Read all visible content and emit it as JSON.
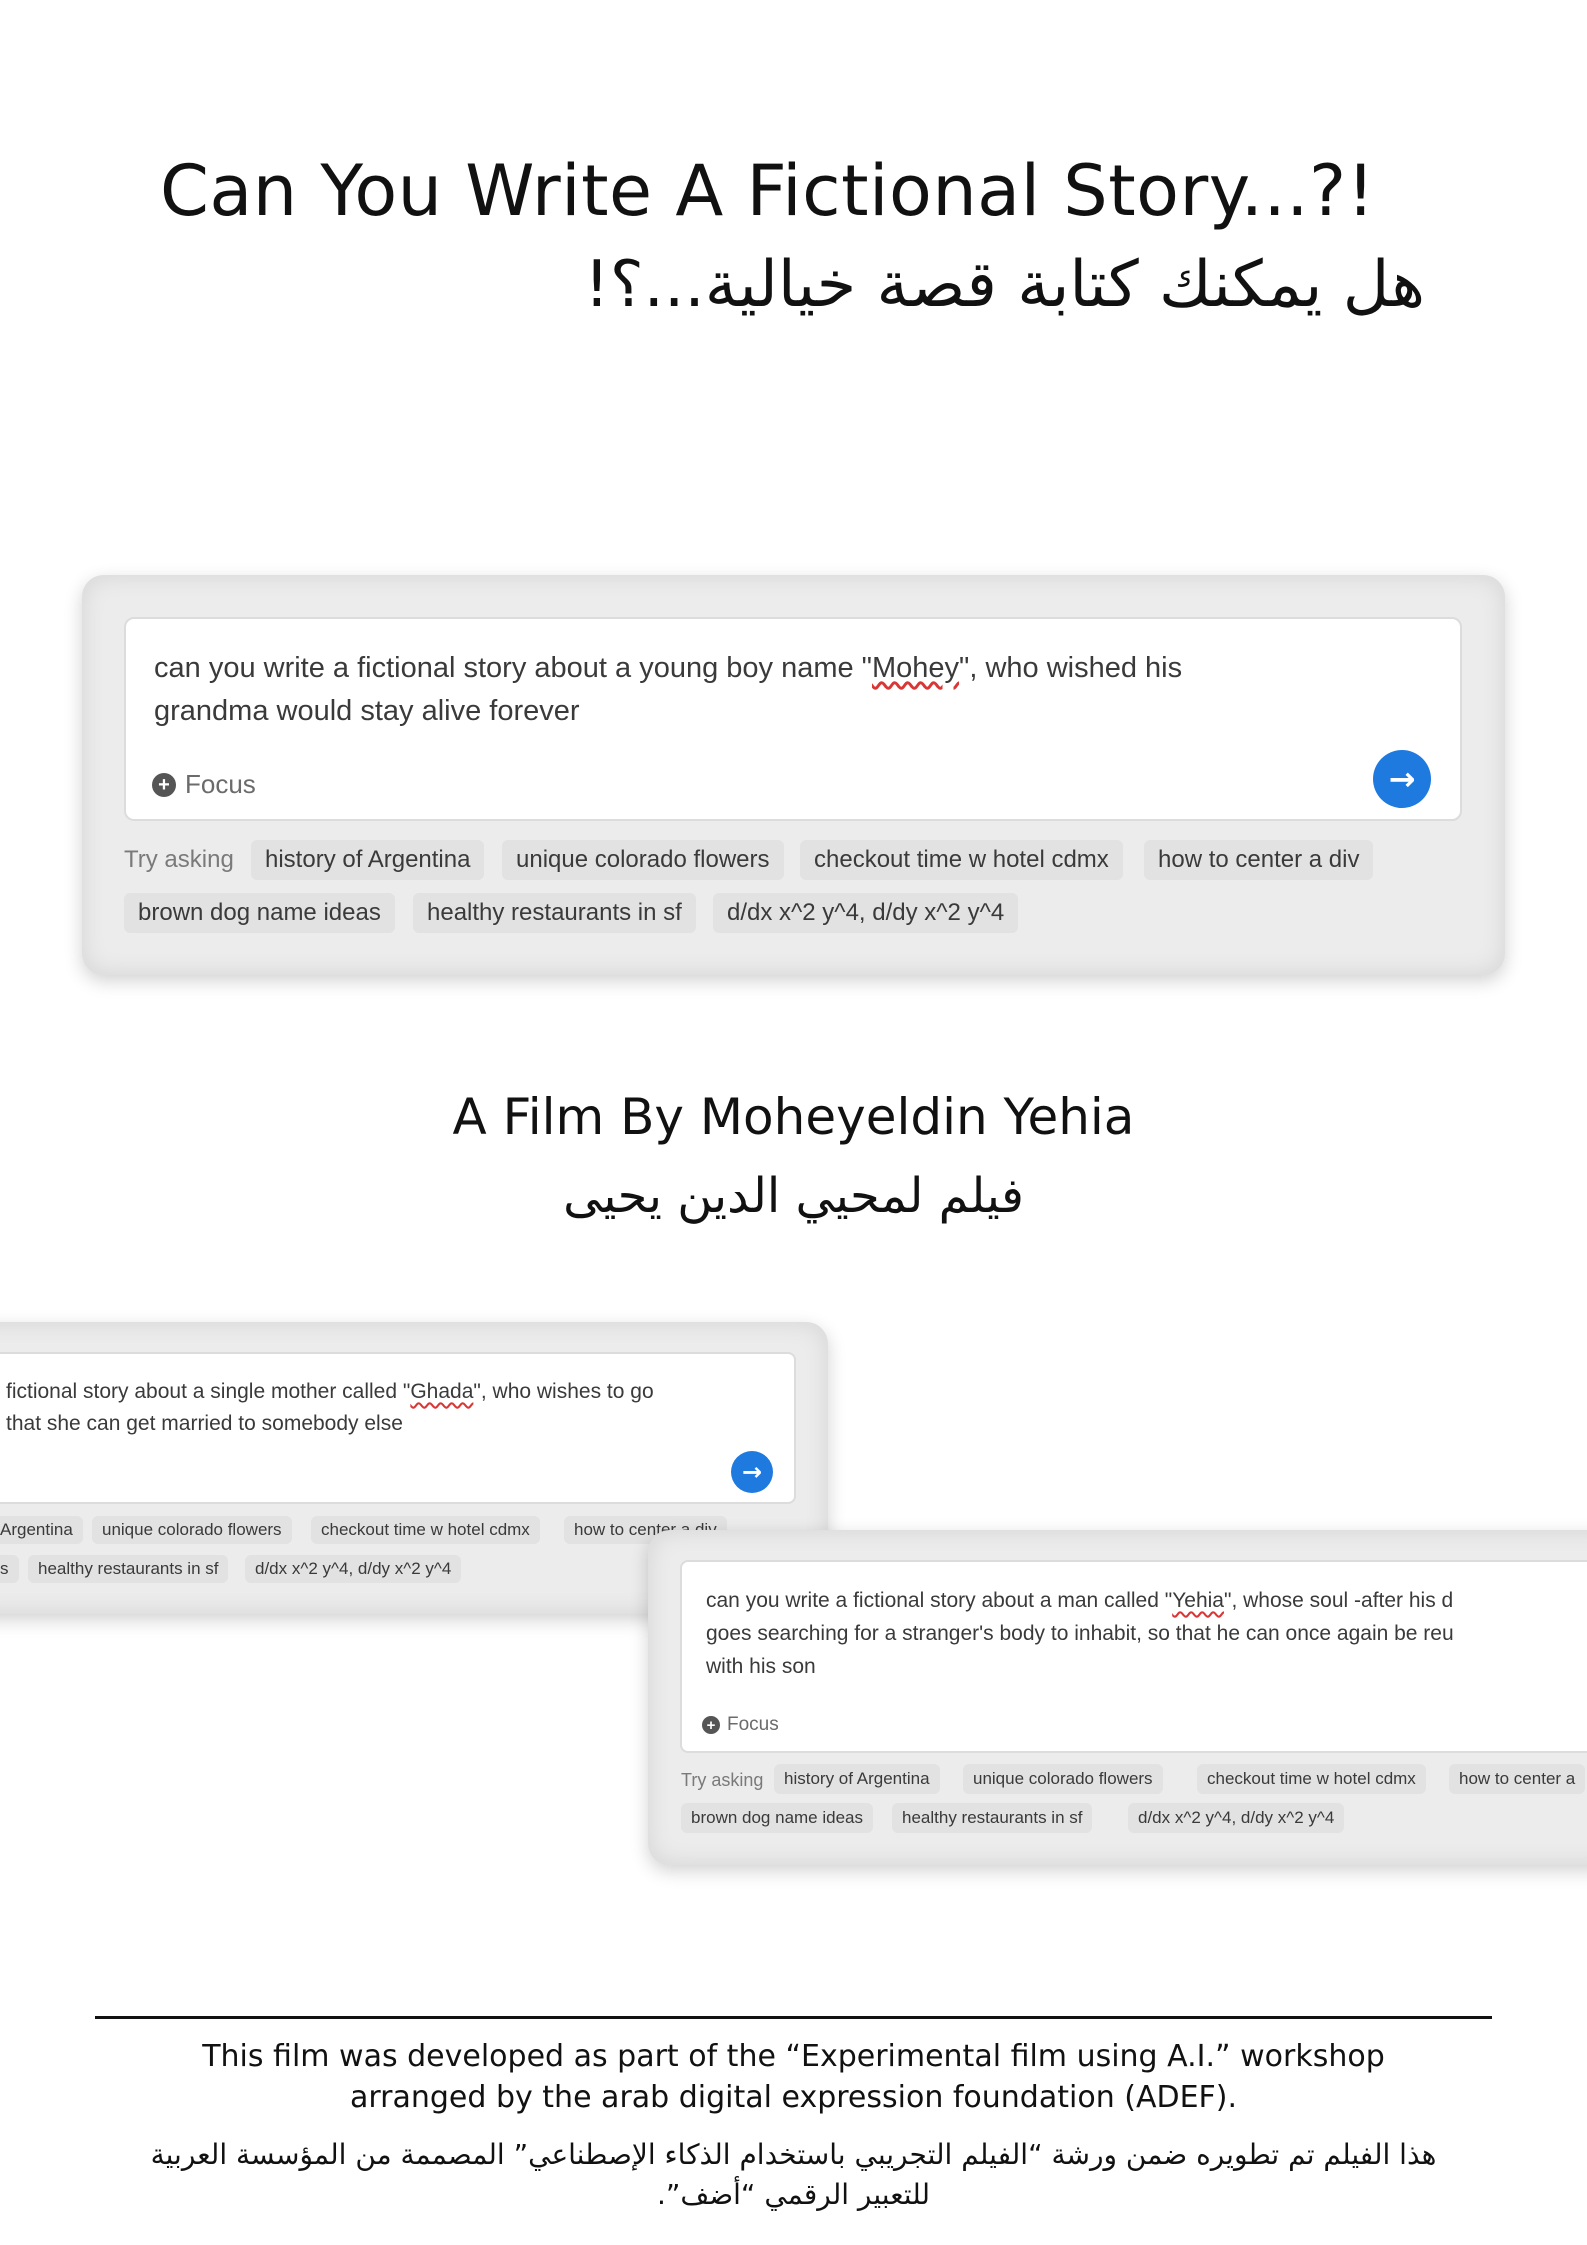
{
  "header": {
    "title_en": "Can You Write A Fictional Story...?!",
    "title_ar": "هل يمكنك كتابة قصة خيالية...؟!"
  },
  "card_main": {
    "query_line1_before": "can you write a fictional story about a young boy name \"",
    "query_name": "Mohey",
    "query_line1_after": "\", who wished his",
    "query_line2": "grandma would stay alive forever",
    "focus_label": "Focus",
    "try_asking": "Try asking",
    "chips_row1": [
      "history of Argentina",
      "unique colorado flowers",
      "checkout time w hotel cdmx",
      "how to center a div"
    ],
    "chips_row2": [
      "brown dog name ideas",
      "healthy restaurants in sf",
      "d/dx x^2 y^4, d/dy x^2 y^4"
    ]
  },
  "film": {
    "credit_en": "A Film By Moheyeldin Yehia",
    "credit_ar": "فيلم لمحيي الدين يحيى"
  },
  "card_left": {
    "query_line1_before": "fictional story about a single mother called \"",
    "query_name": "Ghada",
    "query_line1_after": "\", who wishes to go",
    "query_line2": "that she can get married to somebody else",
    "chips_row1": [
      "Argentina",
      "unique colorado flowers",
      "checkout time w hotel cdmx",
      "how to center a div"
    ],
    "chips_row2": [
      "s",
      "healthy restaurants in sf",
      "d/dx x^2 y^4, d/dy x^2 y^4"
    ]
  },
  "card_right": {
    "query_line1_before": "can you write a fictional story about a man called \"",
    "query_name": "Yehia",
    "query_line1_after": "\", whose soul -after his d",
    "query_line2": "goes searching for a stranger's body to inhabit, so that he can once again be reu",
    "query_line3": "with his son",
    "focus_label": "Focus",
    "try_asking": "Try asking",
    "chips_row1": [
      "history of Argentina",
      "unique colorado flowers",
      "checkout time w hotel cdmx",
      "how to center a"
    ],
    "chips_row2": [
      "brown dog name ideas",
      "healthy restaurants in sf",
      "d/dx x^2 y^4, d/dy x^2 y^4"
    ]
  },
  "footer": {
    "text_en": "This film was developed as part of the “Experimental film using A.I.” workshop arranged by the arab digital expression foundation (ADEF).",
    "text_ar": "هذا الفيلم تم تطويره ضمن ورشة “الفيلم التجريبي باستخدام الذكاء الإصطناعي” المصممة من المؤسسة العربية للتعبير الرقمي “أضف”."
  },
  "icons": {
    "send": "arrow-right-icon",
    "focus": "plus-circle-icon"
  },
  "colors": {
    "accent": "#1f7ae0",
    "card_bg": "#ececec",
    "chip_bg": "#e2e2e2"
  }
}
